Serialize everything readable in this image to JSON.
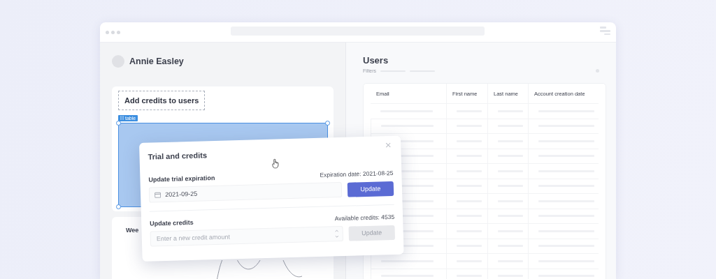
{
  "profile": {
    "name": "Annie Easley"
  },
  "editor": {
    "heading": "Add credits to users",
    "component_tag": "table",
    "selected": true,
    "chart_card": {
      "title": "Wee"
    }
  },
  "users": {
    "title": "Users",
    "filters_label": "Filters",
    "columns": [
      "Email",
      "First name",
      "Last name",
      "Account creation date"
    ]
  },
  "dialog": {
    "title": "Trial and credits",
    "sections": [
      {
        "label": "Update trial expiration",
        "info": "Expiration date: 2021-08-25",
        "field": {
          "kind": "date",
          "value": "2021-09-25"
        },
        "button": {
          "label": "Update",
          "disabled": false
        }
      },
      {
        "label": "Update credits",
        "info": "Available credits: 4535",
        "field": {
          "kind": "number",
          "placeholder": "Enter a new credit amount"
        },
        "button": {
          "label": "Update",
          "disabled": true
        }
      }
    ]
  }
}
